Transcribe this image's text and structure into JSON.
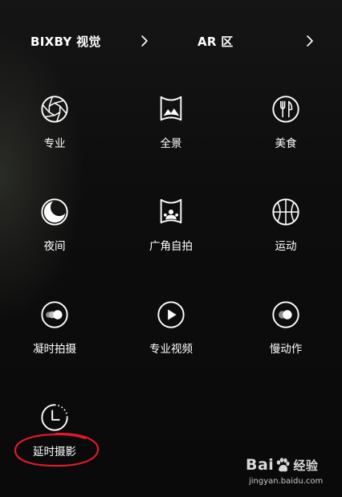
{
  "header": {
    "left_label": "BIXBY 视觉",
    "right_label": "AR 区"
  },
  "modes": [
    {
      "id": "pro",
      "label": "专业",
      "icon": "aperture-icon"
    },
    {
      "id": "panorama",
      "label": "全景",
      "icon": "panorama-icon"
    },
    {
      "id": "food",
      "label": "美食",
      "icon": "fork-knife-icon"
    },
    {
      "id": "night",
      "label": "夜间",
      "icon": "moon-icon"
    },
    {
      "id": "wide-selfie",
      "label": "广角自拍",
      "icon": "wide-selfie-icon"
    },
    {
      "id": "sports",
      "label": "运动",
      "icon": "basketball-icon"
    },
    {
      "id": "super-slow-mo",
      "label": "凝时拍摄",
      "icon": "super-slow-icon"
    },
    {
      "id": "pro-video",
      "label": "专业视频",
      "icon": "play-icon"
    },
    {
      "id": "slow-motion",
      "label": "慢动作",
      "icon": "slow-motion-icon"
    },
    {
      "id": "hyperlapse",
      "label": "延时摄影",
      "icon": "timer-icon"
    }
  ],
  "annotation": {
    "color": "#e0192c",
    "target": "延时摄影"
  },
  "watermark": {
    "brand_left": "Bai",
    "brand_right": "经验",
    "url": "jingyan.baidu.com"
  }
}
